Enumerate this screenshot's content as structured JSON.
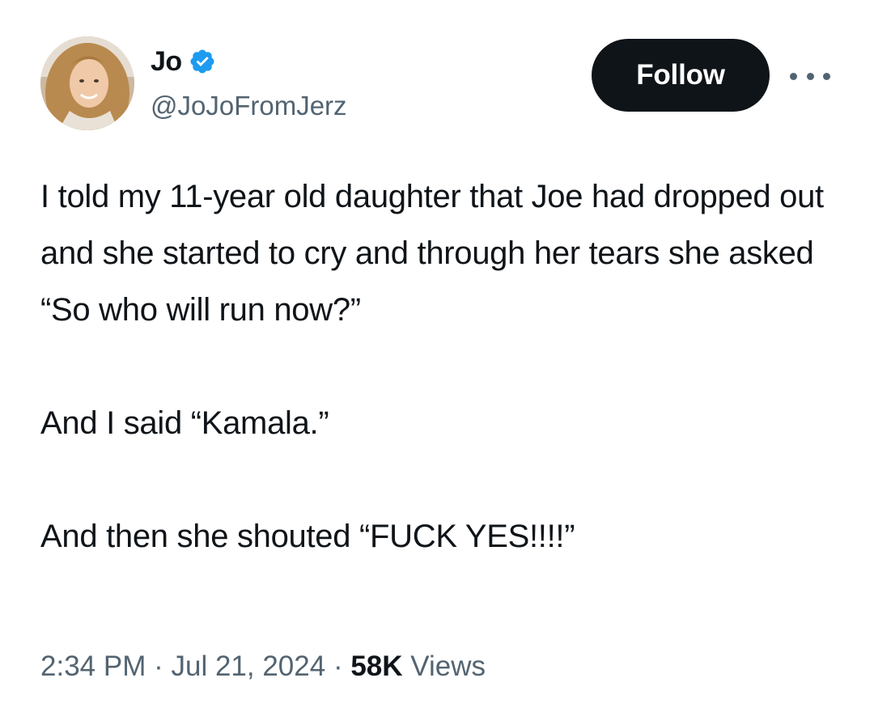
{
  "user": {
    "display_name": "Jo",
    "handle": "@JoJoFromJerz",
    "verified_icon": "verified-badge-icon",
    "verified_color": "#1d9bf0"
  },
  "actions": {
    "follow_label": "Follow",
    "more_icon": "more-options-icon"
  },
  "tweet": {
    "paragraphs": [
      "I told my 11-year old daughter that Joe had dropped out and she started to cry and through her tears she asked “So who will run now?”",
      "And I said “Kamala.”",
      "And then she shouted “FUCK YES!!!!”"
    ],
    "time": "2:34 PM",
    "separator": "·",
    "date": "Jul 21, 2024",
    "views_count": "58K",
    "views_label": "Views"
  },
  "colors": {
    "text": "#0f1419",
    "secondary": "#536471",
    "follow_bg": "#0f1419",
    "follow_text": "#ffffff"
  }
}
